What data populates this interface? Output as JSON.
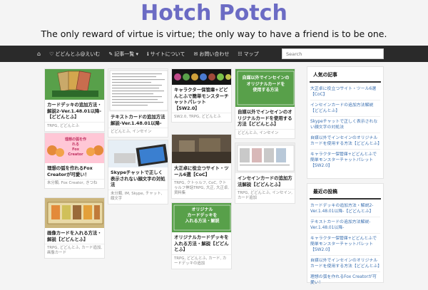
{
  "site": {
    "title": "Hotch Potch",
    "description": "The only reward of virtue is virtue; the only way to have a friend is to be one."
  },
  "nav": {
    "items": [
      {
        "icon": "home-icon",
        "glyph": "⌂",
        "label": ""
      },
      {
        "icon": "heart-icon",
        "glyph": "♡",
        "label": "どどんとふ@えいむ"
      },
      {
        "icon": "pencil-icon",
        "glyph": "✎",
        "label": "記事一覧 ▾"
      },
      {
        "icon": "info-icon",
        "glyph": "ℹ",
        "label": "サイトについて"
      },
      {
        "icon": "mail-icon",
        "glyph": "✉",
        "label": "お問い合わせ"
      },
      {
        "icon": "sitemap-icon",
        "glyph": "☷",
        "label": "マップ"
      }
    ],
    "search_placeholder": "Search"
  },
  "posts": [
    {
      "title": "カードデッキの追加方法・解説2-Ver.1.48.01以降-【どどんとふ】",
      "meta": "TRPG, どどんとふ",
      "thumb": "cards-green"
    },
    {
      "title": "テキストカードの追加方法解説-Ver.1.48.01以降-",
      "meta": "どどんとふ, インセイン",
      "thumb": "text-doc"
    },
    {
      "title": "キャラクター保管庫+どどんとふで簡単モンスターチャットパレット【SW2.0】",
      "meta": "SW2.0, TRPG, どどんとふ",
      "thumb": "monsters"
    },
    {
      "title": "自媒以外でインセインのオリジナルカードを使用する方法【どどんとふ】",
      "meta": "どどんとふ, インセイン",
      "thumb": "insane-green"
    },
    {
      "title": "理想の弧を作れるFox Creatorが可愛い！",
      "meta": "未分類, Fox Creator, きつね",
      "thumb": "foxes"
    },
    {
      "title": "Skypeチャットで正しく表示されない顔文字の対処法",
      "meta": "未分類, IM, Skype, チャット, 顔文字",
      "thumb": "skype"
    },
    {
      "title": "大正卓に役立つサイト・ツール6選【CoC】",
      "meta": "TRPG, クトゥルフ, CoC, クトゥルフ神話TRPG, 大正, 大正卓, 資料集",
      "thumb": "taisho"
    },
    {
      "title": "インセインカードの追加方法解説【どどんとふ】",
      "meta": "TRPG, どどんとふ, インセイン, カード追加",
      "thumb": "insane-cards"
    },
    {
      "title": "画像カードを入れる方法・解説【どどんとふ】",
      "meta": "TRPG, どどんとふ, カード追加, 画像カード",
      "thumb": "image-cards"
    },
    {
      "title": "オリジナルカードデッキを入れる方法・解説【どどんとふ】",
      "meta": "TRPG, どどんとふ, カード, カードデッキの追加",
      "thumb": "original-deck"
    }
  ],
  "thumbs": {
    "insane_label": "自媒以外でインセインの\nオリジナルカードを\n使用する方法",
    "original_label": "オリジナル\nカードデッキを\n入れる方法・解説",
    "fox_label_1": "理想の弧を作れる",
    "fox_label_2": "Fox Creator"
  },
  "sidebar": {
    "popular_title": "人気の記事",
    "popular": [
      "大正卓に役立つサイト・ツール6選【CoC】",
      "インセインカードの追加方法解説【どどんとふ】",
      "Skypeチャットで正しく表示されない顔文字の対処法",
      "自媒以外でインセインのオリジナルカードを使用する方法【どどんとふ】",
      "キャラクター保管庫+どどんとふで簡単モンスターチャットパレット【SW2.0】"
    ],
    "recent_title": "最近の投稿",
    "recent": [
      "カードデッキの追加方法・解説2-Ver.1.48.01以降-【どどんとふ】",
      "テキストカードの追加方法解説-Ver.1.48.01以降-",
      "キャラクター保管庫+どどんとふで簡単モンスターチャットパレット【SW2.0】",
      "自媒以外でインセインのオリジナルカードを使用する方法【どどんとふ】",
      "理想の弧を作れるFox Creatorが可愛い！"
    ]
  },
  "colors": {
    "title": "#6b6bc4",
    "nav_bg": "#2a2a2a",
    "link": "#3a6fb0"
  }
}
